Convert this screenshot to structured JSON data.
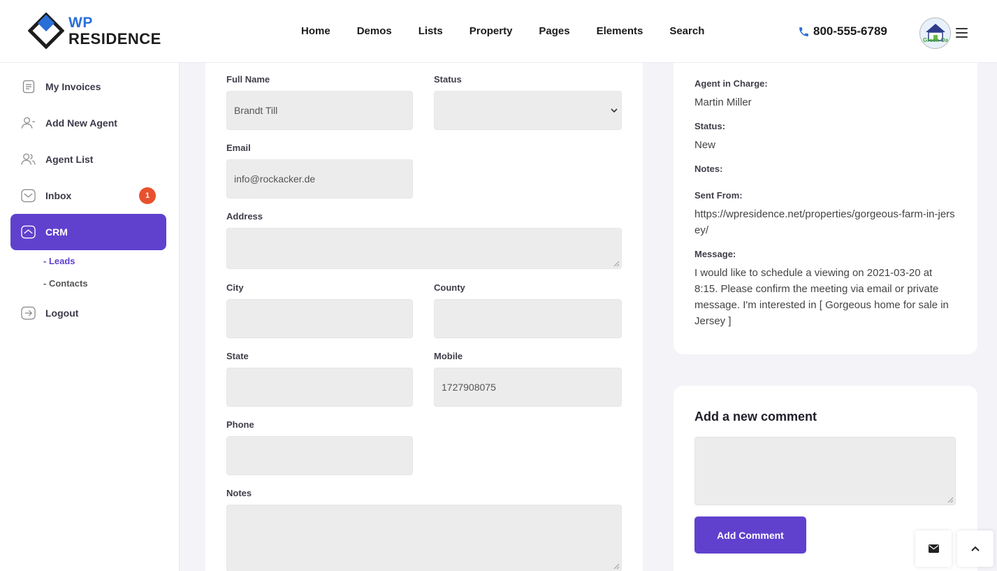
{
  "brand": {
    "line1": "WP",
    "line2": "RESIDENCE"
  },
  "nav": [
    "Home",
    "Demos",
    "Lists",
    "Property",
    "Pages",
    "Elements",
    "Search"
  ],
  "phone": "800-555-6789",
  "avatar_text": "Green Oa",
  "sidebar": {
    "items": [
      {
        "label": "My Invoices"
      },
      {
        "label": "Add New Agent"
      },
      {
        "label": "Agent List"
      },
      {
        "label": "Inbox",
        "badge": "1"
      },
      {
        "label": "CRM"
      },
      {
        "label": "Logout"
      }
    ],
    "sub_items": [
      "- Leads",
      "- Contacts"
    ]
  },
  "form": {
    "full_name_label": "Full Name",
    "full_name_value": "Brandt Till",
    "status_label": "Status",
    "status_value": "",
    "email_label": "Email",
    "email_value": "info@rockacker.de",
    "address_label": "Address",
    "address_value": "",
    "city_label": "City",
    "city_value": "",
    "county_label": "County",
    "county_value": "",
    "state_label": "State",
    "state_value": "",
    "mobile_label": "Mobile",
    "mobile_value": "1727908075",
    "phone_label": "Phone",
    "phone_value": "",
    "notes_label": "Notes",
    "notes_value": ""
  },
  "details": {
    "agent_label": "Agent in Charge:",
    "agent_value": "Martin Miller",
    "status_label": "Status:",
    "status_value": "New",
    "notes_label": "Notes:",
    "sent_from_label": "Sent From:",
    "sent_from_value": "https://wpresidence.net/properties/gorgeous-farm-in-jersey/",
    "message_label": "Message:",
    "message_value": "I would like to schedule a viewing on 2021-03-20 at 8:15. Please confirm the meeting via email or private message. I'm interested in [ Gorgeous home for sale in Jersey ]"
  },
  "comment": {
    "title": "Add a new comment",
    "button": "Add Comment"
  },
  "colors": {
    "accent": "#6041ce",
    "badge": "#e8512d",
    "brand_blue": "#2a6fd8"
  }
}
